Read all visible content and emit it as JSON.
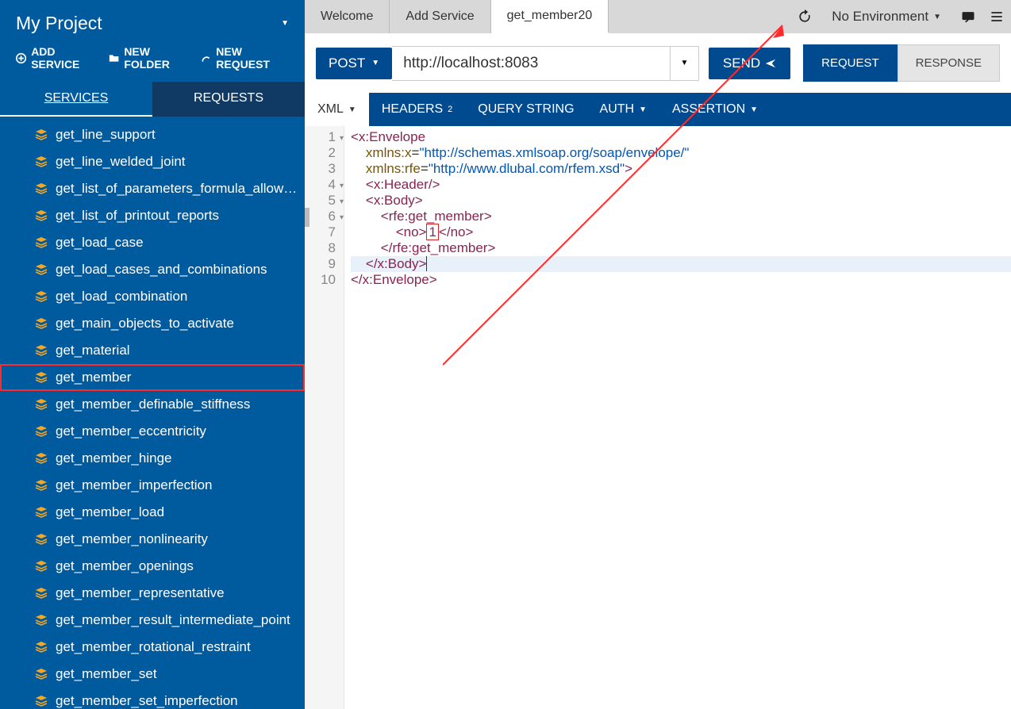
{
  "sidebar": {
    "title": "My Project",
    "add_service": "ADD SERVICE",
    "new_folder": "NEW FOLDER",
    "new_request": "NEW REQUEST",
    "tabs": {
      "services": "SERVICES",
      "requests": "REQUESTS"
    },
    "items": [
      "get_line_support",
      "get_line_welded_joint",
      "get_list_of_parameters_formula_allow…",
      "get_list_of_printout_reports",
      "get_load_case",
      "get_load_cases_and_combinations",
      "get_load_combination",
      "get_main_objects_to_activate",
      "get_material",
      "get_member",
      "get_member_definable_stiffness",
      "get_member_eccentricity",
      "get_member_hinge",
      "get_member_imperfection",
      "get_member_load",
      "get_member_nonlinearity",
      "get_member_openings",
      "get_member_representative",
      "get_member_result_intermediate_point",
      "get_member_rotational_restraint",
      "get_member_set",
      "get_member_set_imperfection"
    ],
    "highlight_index": 9
  },
  "top_tabs": [
    {
      "label": "Welcome",
      "active": false
    },
    {
      "label": "Add Service",
      "active": false
    },
    {
      "label": "get_member20",
      "active": true
    }
  ],
  "env_label": "No Environment",
  "request_row": {
    "method": "POST",
    "url": "http://localhost:8083",
    "send": "SEND"
  },
  "toggle": {
    "request": "REQUEST",
    "response": "RESPONSE"
  },
  "subtabs": {
    "xml": "XML",
    "headers": "HEADERS",
    "headers_badge": "2",
    "query": "QUERY STRING",
    "auth": "AUTH",
    "assertion": "ASSERTION"
  },
  "code": {
    "lines": [
      {
        "n": 1,
        "fold": true
      },
      {
        "n": 2
      },
      {
        "n": 3
      },
      {
        "n": 4,
        "fold": true
      },
      {
        "n": 5,
        "fold": true
      },
      {
        "n": 6,
        "fold": true
      },
      {
        "n": 7
      },
      {
        "n": 8
      },
      {
        "n": 9
      },
      {
        "n": 10
      }
    ],
    "xmlns_x": "http://schemas.xmlsoap.org/soap/envelope/",
    "xmlns_rfe": "http://www.dlubal.com/rfem.xsd",
    "no_value": "1"
  }
}
